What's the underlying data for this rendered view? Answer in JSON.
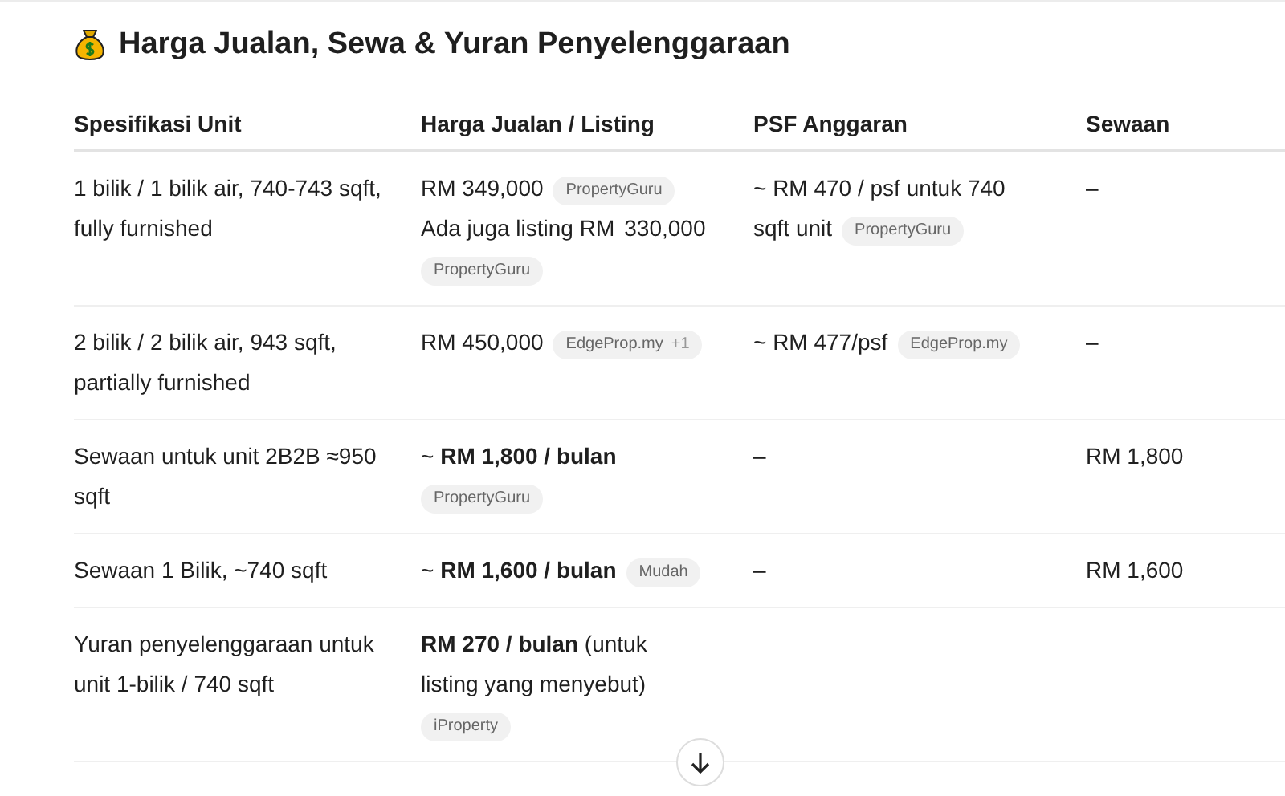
{
  "heading": {
    "title": "Harga Jualan, Sewa & Yuran Penyelenggaraan"
  },
  "table": {
    "columns": [
      "Spesifikasi Unit",
      "Harga Jualan / Listing",
      "PSF Anggaran",
      "Sewaan"
    ],
    "rows": [
      {
        "cells": [
          [
            {
              "kind": "text",
              "text": "1 bilik / 1 bilik air, 740-743 sqft, fully furnished"
            }
          ],
          [
            {
              "kind": "text",
              "text": "RM 349,000"
            },
            {
              "kind": "source",
              "label": "PropertyGuru"
            },
            {
              "kind": "text",
              "text": "Ada juga listing RM"
            },
            {
              "kind": "text",
              "text": "330,000"
            },
            {
              "kind": "source",
              "label": "PropertyGuru"
            }
          ],
          [
            {
              "kind": "text",
              "text": "~ RM 470 / psf untuk 740"
            },
            {
              "kind": "text",
              "text": "sqft unit"
            },
            {
              "kind": "source",
              "label": "PropertyGuru"
            }
          ],
          [
            {
              "kind": "text",
              "text": "–"
            }
          ]
        ]
      },
      {
        "cells": [
          [
            {
              "kind": "text",
              "text": "2 bilik / 2 bilik air, 943 sqft, partially furnished"
            }
          ],
          [
            {
              "kind": "text",
              "text": "RM 450,000"
            },
            {
              "kind": "source",
              "label": "EdgeProp.my",
              "more": "+1"
            }
          ],
          [
            {
              "kind": "text",
              "text": "~ RM 477/psf"
            },
            {
              "kind": "source",
              "label": "EdgeProp.my"
            }
          ],
          [
            {
              "kind": "text",
              "text": "–"
            }
          ]
        ]
      },
      {
        "cells": [
          [
            {
              "kind": "text",
              "text": "Sewaan untuk unit 2B2B ≈950 sqft"
            }
          ],
          [
            {
              "kind": "text",
              "text": "~ **RM 1,800 / bulan**"
            },
            {
              "kind": "source",
              "label": "PropertyGuru"
            }
          ],
          [
            {
              "kind": "text",
              "text": "–"
            }
          ],
          [
            {
              "kind": "text",
              "text": "RM 1,800"
            }
          ]
        ]
      },
      {
        "cells": [
          [
            {
              "kind": "text",
              "text": "Sewaan 1 Bilik, ~740 sqft"
            }
          ],
          [
            {
              "kind": "text",
              "text": "~ **RM 1,600 / bulan**"
            },
            {
              "kind": "source",
              "label": "Mudah"
            }
          ],
          [
            {
              "kind": "text",
              "text": "–"
            }
          ],
          [
            {
              "kind": "text",
              "text": "RM 1,600"
            }
          ]
        ]
      },
      {
        "cells": [
          [
            {
              "kind": "text",
              "text": "Yuran penyelenggaraan untuk unit 1-bilik / 740 sqft"
            }
          ],
          [
            {
              "kind": "text",
              "text": "**RM 270 / bulan** (untuk"
            },
            {
              "kind": "text",
              "text": "listing yang menyebut)"
            },
            {
              "kind": "source",
              "label": "iProperty"
            }
          ],
          [],
          []
        ]
      }
    ]
  }
}
